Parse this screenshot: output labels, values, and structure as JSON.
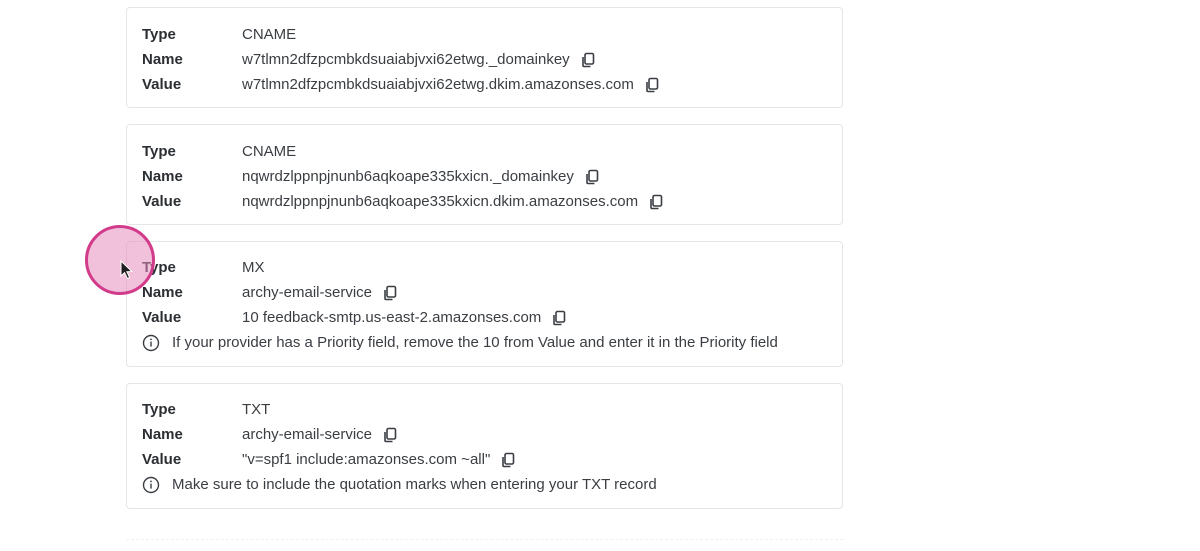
{
  "labels": {
    "type": "Type",
    "name": "Name",
    "value": "Value"
  },
  "records": [
    {
      "type": "CNAME",
      "name": "w7tlmn2dfzpcmbkdsuaiabjvxi62etwg._domainkey",
      "value": "w7tlmn2dfzpcmbkdsuaiabjvxi62etwg.dkim.amazonses.com"
    },
    {
      "type": "CNAME",
      "name": "nqwrdzlppnpjnunb6aqkoape335kxicn._domainkey",
      "value": "nqwrdzlppnpjnunb6aqkoape335kxicn.dkim.amazonses.com"
    },
    {
      "type": "MX",
      "name": "archy-email-service",
      "value": "10 feedback-smtp.us-east-2.amazonses.com",
      "note": "If your provider has a Priority field, remove the 10 from Value and enter it in the Priority field"
    },
    {
      "type": "TXT",
      "name": "archy-email-service",
      "value": "\"v=spf1 include:amazonses.com ~all\"",
      "note": "Make sure to include the quotation marks when entering your TXT record"
    }
  ],
  "icons": {
    "copy": "copy-icon",
    "info": "info-icon",
    "cursor": "mouse-pointer-icon"
  },
  "colors": {
    "card_border": "#e3e5e8",
    "text": "#2f3338",
    "cursor_ring": "#d23b8a",
    "cursor_fill": "#e68cbe"
  }
}
